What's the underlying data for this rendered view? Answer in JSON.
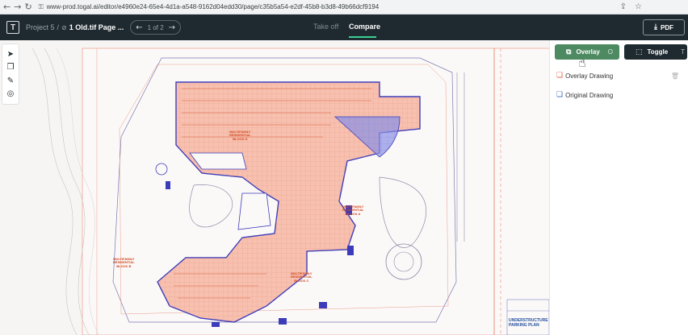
{
  "browser": {
    "back": "←",
    "forward": "→",
    "reload": "↻",
    "url": "www-prod.togal.ai/editor/e4960e24-65e4-4d1a-a548-9162d04edd30/page/c35b5a54-e2df-45b8-b3d8-49b66dcf9194"
  },
  "header": {
    "logo": "T",
    "project": "Project 5",
    "separator": "/",
    "file_name": "1 Old.tif Page ...",
    "page_indicator": "1 of 2",
    "tabs": [
      {
        "label": "Take off"
      },
      {
        "label": "Compare"
      }
    ],
    "pdf_label": "PDF"
  },
  "panel": {
    "overlay_label": "Overlay",
    "overlay_shortcut": "O",
    "toggle_label": "Toggle",
    "toggle_shortcut": "T",
    "layers": [
      {
        "label": "Overlay Drawing"
      },
      {
        "label": "Original Drawing"
      }
    ]
  },
  "drawing": {
    "labels": {
      "block_a": "MULTIFAMILY\nRESIDENTIAL\nBLOCK A",
      "block_b": "MULTIFAMILY\nRESIDENTIAL\nBLOCK B",
      "block_c": "MULTIFAMILY\nRESIDENTIAL\nBLOCK C",
      "block_d": "MULTIFAMILY\nRESIDENTIAL\nBLOCK D"
    },
    "title_block": "UNDERSTRUCTURE\nPARKING PLAN"
  },
  "colors": {
    "header_bg": "#1f2a30",
    "overlay_green": "#4d8a62",
    "accent_underline": "#3ccf91",
    "drawing_red": "#e2573a",
    "drawing_blue": "#3c4fc8"
  }
}
